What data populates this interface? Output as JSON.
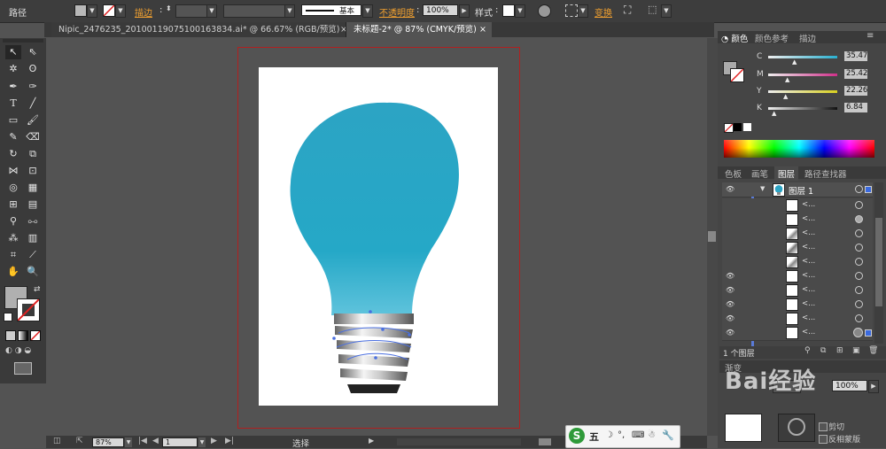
{
  "control_bar": {
    "path_label": "路径",
    "stroke_label": "描边",
    "stroke_style": "基本",
    "opacity_label": "不透明度",
    "opacity_value": "100%",
    "style_label": "样式",
    "transform_label": "变换"
  },
  "tabs": [
    {
      "label": "Nipic_2476235_20100119075100163834.ai* @ 66.67% (RGB/预览)",
      "close": "×"
    },
    {
      "label": "未标题-2* @ 87% (CMYK/预览)",
      "close": "×"
    }
  ],
  "color_panel": {
    "tabs": [
      "颜色",
      "颜色参考",
      "描边"
    ],
    "channels": [
      {
        "name": "C",
        "value": "35.47"
      },
      {
        "name": "M",
        "value": "25.42"
      },
      {
        "name": "Y",
        "value": "22.26"
      },
      {
        "name": "K",
        "value": "6.84"
      }
    ],
    "colors": {
      "c_track": "#29b0d0",
      "m_track": "#d0308a",
      "y_track": "#d8d020",
      "k_track": "#111111"
    }
  },
  "layers_panel": {
    "tabs": [
      "色板",
      "画笔",
      "图层",
      "路径查找器"
    ],
    "layer_name": "图层 1",
    "row_label": "<...",
    "footer_count": "1 个图层"
  },
  "transparency_panel": {
    "tab": "渐变",
    "opacity_value": "100%",
    "clip_label": "剪切",
    "invert_label": "反相蒙版"
  },
  "status_bar": {
    "zoom": "87%",
    "page": "1",
    "tool_status": "选择"
  },
  "ime": {
    "mode": "五"
  },
  "watermark": "Bai经验"
}
